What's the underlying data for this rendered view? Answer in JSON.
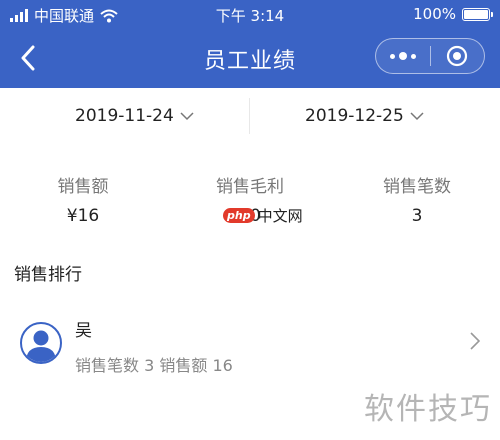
{
  "status_bar": {
    "carrier": "中国联通",
    "time": "下午 3:14",
    "battery": "100%",
    "battery_level": 1.0
  },
  "nav": {
    "title": "员工业绩",
    "back_icon": "chevron-left-icon",
    "more_icon": "more-dots-icon",
    "close_icon": "target-circle-icon"
  },
  "dates": {
    "start": "2019-11-24",
    "end": "2019-12-25"
  },
  "stats": [
    {
      "label": "销售额",
      "value": "¥16"
    },
    {
      "label": "销售毛利",
      "value": "¥0"
    },
    {
      "label": "销售笔数",
      "value": "3"
    }
  ],
  "ranking": {
    "title": "销售排行",
    "items": [
      {
        "name": "吴",
        "detail": "销售笔数 3 销售额 16"
      }
    ]
  },
  "watermarks": {
    "php_logo": "php",
    "php_text": "中文网",
    "bottom": "软件技巧"
  },
  "colors": {
    "header": "#3a63c5",
    "background": "#f4f4f4"
  }
}
